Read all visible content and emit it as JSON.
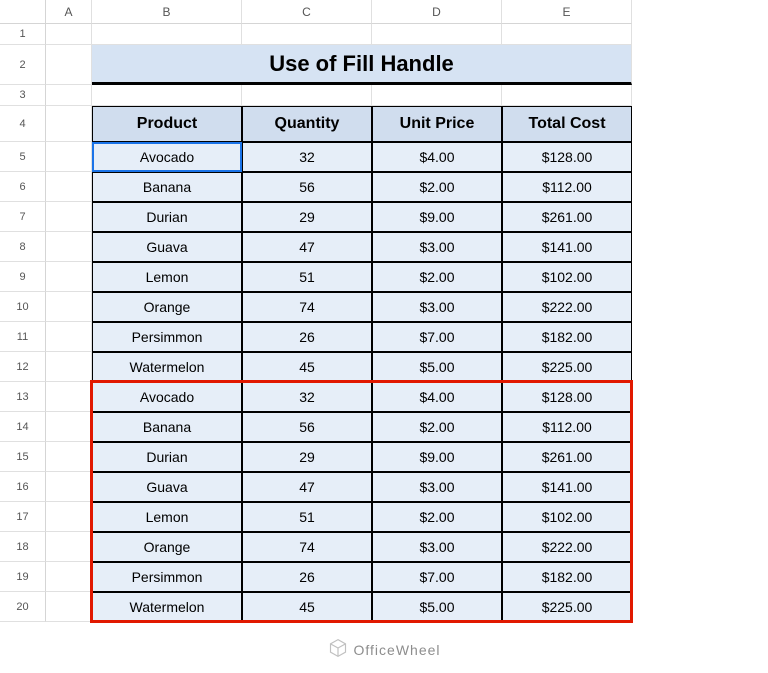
{
  "columns": [
    "",
    "A",
    "B",
    "C",
    "D",
    "E"
  ],
  "row_numbers": [
    1,
    2,
    3,
    4,
    5,
    6,
    7,
    8,
    9,
    10,
    11,
    12,
    13,
    14,
    15,
    16,
    17,
    18,
    19,
    20
  ],
  "title": "Use of Fill Handle",
  "headers": [
    "Product",
    "Quantity",
    "Unit Price",
    "Total Cost"
  ],
  "rows": [
    {
      "product": "Avocado",
      "qty": "32",
      "price": "$4.00",
      "total": "$128.00"
    },
    {
      "product": "Banana",
      "qty": "56",
      "price": "$2.00",
      "total": "$112.00"
    },
    {
      "product": "Durian",
      "qty": "29",
      "price": "$9.00",
      "total": "$261.00"
    },
    {
      "product": "Guava",
      "qty": "47",
      "price": "$3.00",
      "total": "$141.00"
    },
    {
      "product": "Lemon",
      "qty": "51",
      "price": "$2.00",
      "total": "$102.00"
    },
    {
      "product": "Orange",
      "qty": "74",
      "price": "$3.00",
      "total": "$222.00"
    },
    {
      "product": "Persimmon",
      "qty": "26",
      "price": "$7.00",
      "total": "$182.00"
    },
    {
      "product": "Watermelon",
      "qty": "45",
      "price": "$5.00",
      "total": "$225.00"
    },
    {
      "product": "Avocado",
      "qty": "32",
      "price": "$4.00",
      "total": "$128.00"
    },
    {
      "product": "Banana",
      "qty": "56",
      "price": "$2.00",
      "total": "$112.00"
    },
    {
      "product": "Durian",
      "qty": "29",
      "price": "$9.00",
      "total": "$261.00"
    },
    {
      "product": "Guava",
      "qty": "47",
      "price": "$3.00",
      "total": "$141.00"
    },
    {
      "product": "Lemon",
      "qty": "51",
      "price": "$2.00",
      "total": "$102.00"
    },
    {
      "product": "Orange",
      "qty": "74",
      "price": "$3.00",
      "total": "$222.00"
    },
    {
      "product": "Persimmon",
      "qty": "26",
      "price": "$7.00",
      "total": "$182.00"
    },
    {
      "product": "Watermelon",
      "qty": "45",
      "price": "$5.00",
      "total": "$225.00"
    }
  ],
  "watermark": "OfficeWheel"
}
